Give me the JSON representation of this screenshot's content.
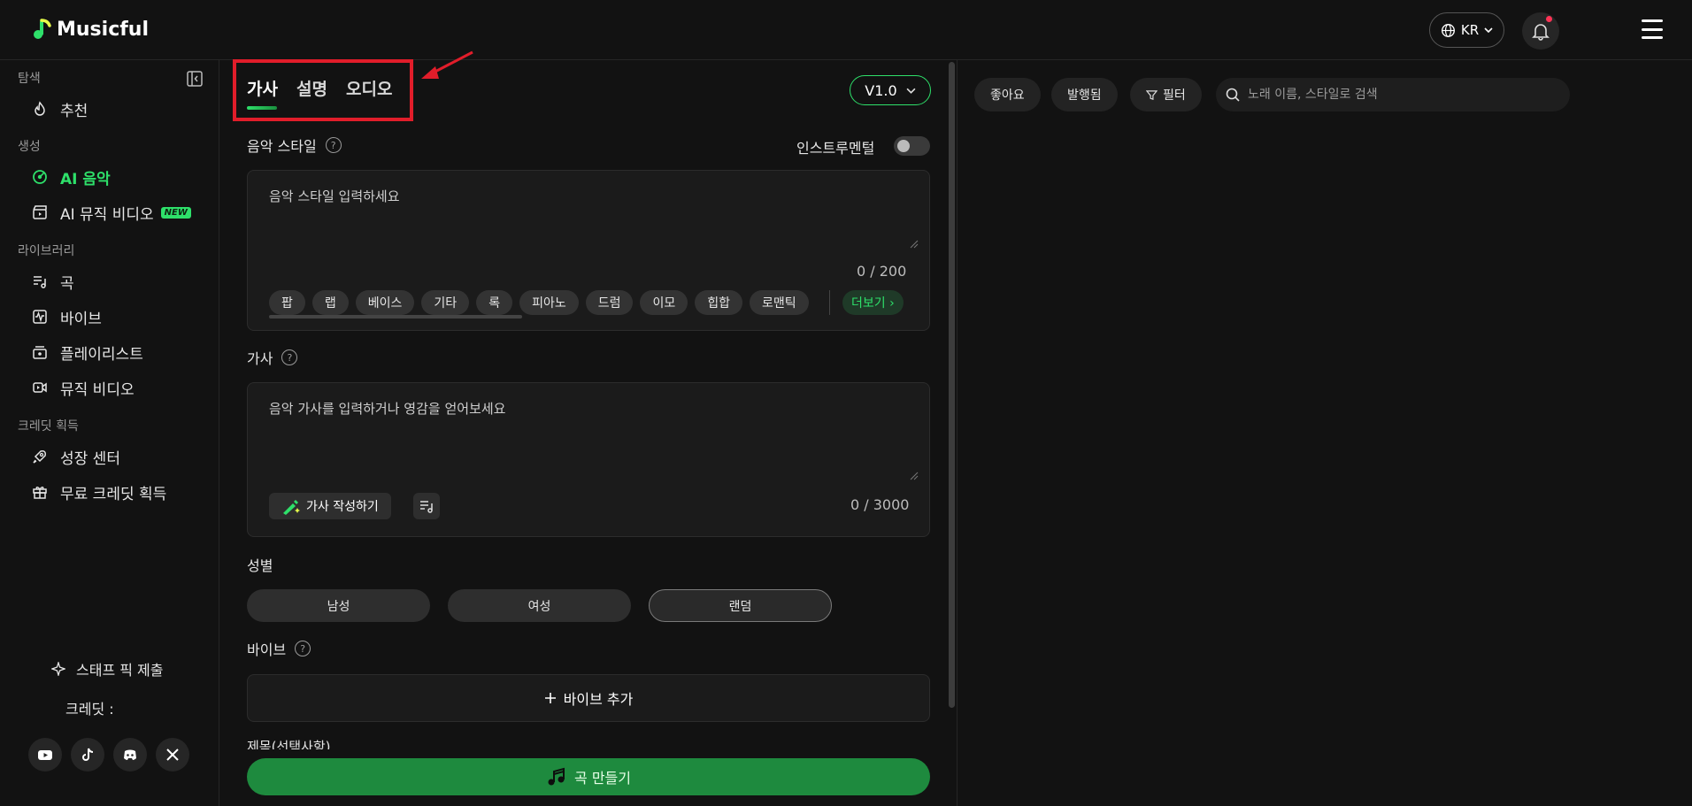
{
  "header": {
    "app_name": "Musicful",
    "language": "KR"
  },
  "sidebar": {
    "sections": {
      "explore": "탐색",
      "create": "생성",
      "library": "라이브러리",
      "earn_credits": "크레딧 획득"
    },
    "items": {
      "recommended": "추천",
      "ai_music": "AI 음악",
      "ai_music_video": "AI 뮤직 비디오",
      "new_badge": "NEW",
      "songs": "곡",
      "vibes": "바이브",
      "playlists": "플레이리스트",
      "music_videos": "뮤직 비디오",
      "growth_center": "성장 센터",
      "free_credits": "무료 크레딧 획득"
    },
    "staff_pick": "스태프 픽 제출",
    "credits_label": "크레딧 :"
  },
  "main": {
    "tabs": [
      "가사",
      "설명",
      "오디오"
    ],
    "version": "V1.0",
    "music_style": {
      "label": "음악 스타일",
      "placeholder": "음악 스타일 입력하세요",
      "counter": "0 / 200",
      "chips": [
        "팝",
        "랩",
        "베이스",
        "기타",
        "록",
        "피아노",
        "드럼",
        "이모",
        "힙합",
        "로맨틱"
      ],
      "more": "더보기 ›"
    },
    "instrumental_label": "인스트루멘털",
    "lyrics": {
      "label": "가사",
      "placeholder": "음악 가사를 입력하거나 영감을 얻어보세요",
      "write_button": "가사 작성하기",
      "counter": "0 / 3000"
    },
    "gender": {
      "label": "성별",
      "options": [
        "남성",
        "여성",
        "랜덤"
      ]
    },
    "vibe": {
      "label": "바이브",
      "add_button": "바이브 추가"
    },
    "cut_label": "제목(선택사항)",
    "create_button": "곡 만들기"
  },
  "right": {
    "filters": {
      "likes": "좋아요",
      "published": "발행됨",
      "filter": "필터"
    },
    "search_placeholder": "노래 이름, 스타일로 검색"
  }
}
